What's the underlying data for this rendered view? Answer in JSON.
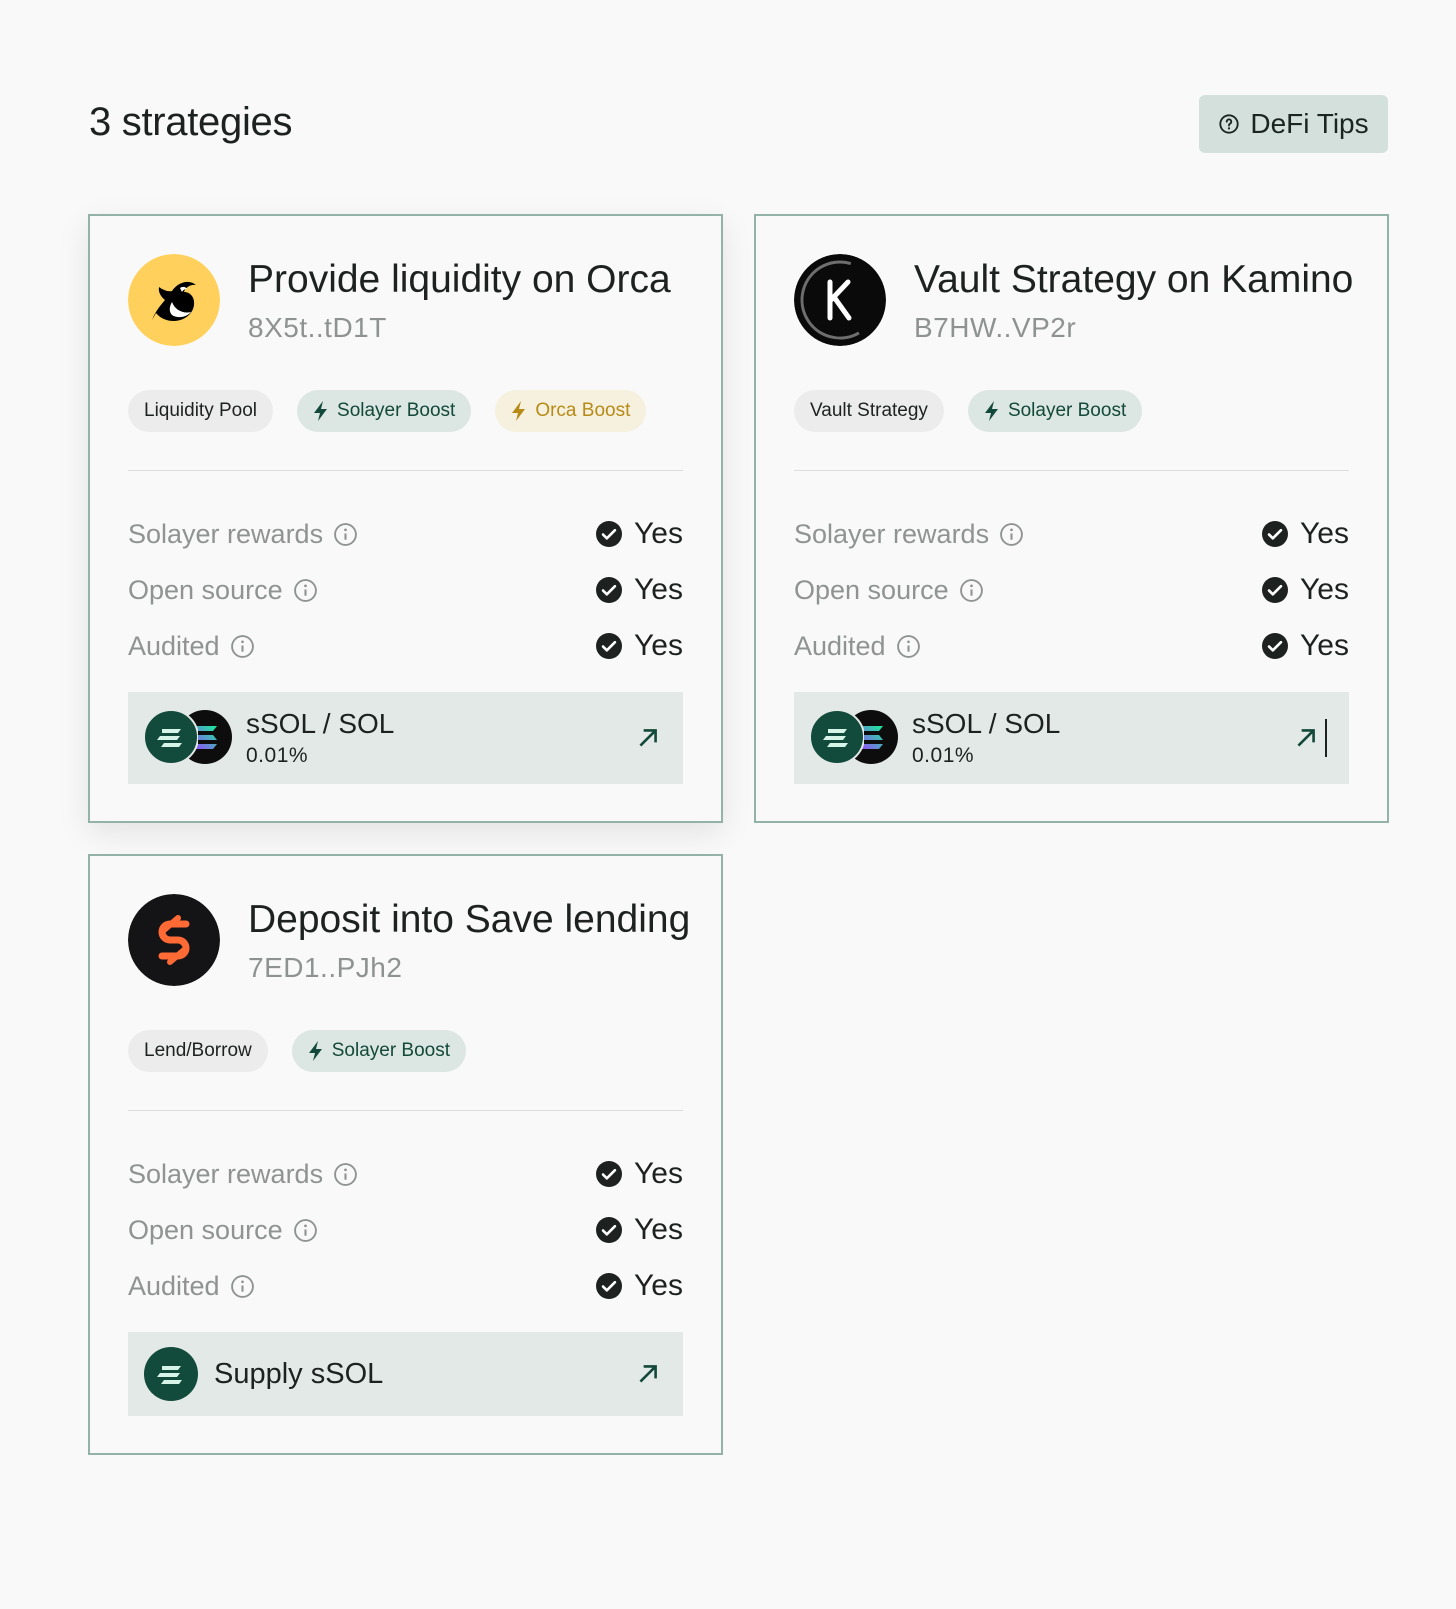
{
  "header": {
    "title": "3 strategies",
    "tips_label": "DeFi Tips"
  },
  "strategies": [
    {
      "title": "Provide liquidity on Orca",
      "address": "8X5t..tD1T",
      "logo": "orca-logo",
      "chips": [
        "Liquidity Pool",
        "Solayer Boost",
        "Orca Boost"
      ],
      "rows": [
        {
          "label": "Solayer rewards",
          "value": "Yes"
        },
        {
          "label": "Open source",
          "value": "Yes"
        },
        {
          "label": "Audited",
          "value": "Yes"
        }
      ],
      "pool": {
        "name": "sSOL / SOL",
        "fee": "0.01%"
      }
    },
    {
      "title": "Vault Strategy on Kamino",
      "address": "B7HW..VP2r",
      "logo": "kamino-logo",
      "chips": [
        "Vault Strategy",
        "Solayer Boost"
      ],
      "rows": [
        {
          "label": "Solayer rewards",
          "value": "Yes"
        },
        {
          "label": "Open source",
          "value": "Yes"
        },
        {
          "label": "Audited",
          "value": "Yes"
        }
      ],
      "pool": {
        "name": "sSOL / SOL",
        "fee": "0.01%"
      }
    },
    {
      "title": "Deposit into Save lending",
      "address": "7ED1..PJh2",
      "logo": "save-logo",
      "chips": [
        "Lend/Borrow",
        "Solayer Boost"
      ],
      "rows": [
        {
          "label": "Solayer rewards",
          "value": "Yes"
        },
        {
          "label": "Open source",
          "value": "Yes"
        },
        {
          "label": "Audited",
          "value": "Yes"
        }
      ],
      "pool": {
        "name": "Supply sSOL"
      }
    }
  ],
  "colors": {
    "card_border": "#93b2a8",
    "accent_green": "#13493a",
    "orca_gold": "#b68b16",
    "pool_bg": "#e2e9e6"
  }
}
